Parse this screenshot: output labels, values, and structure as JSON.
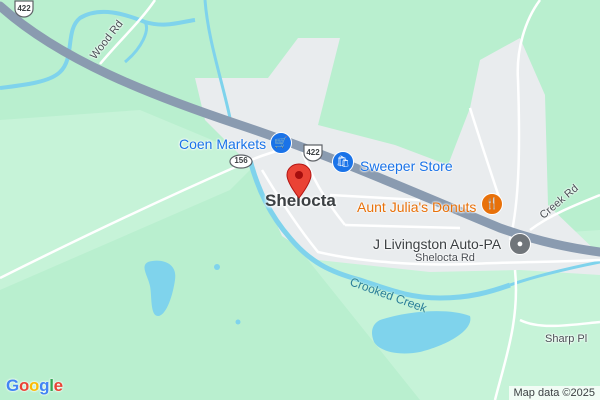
{
  "map": {
    "town": "Shelocta",
    "points_of_interest": [
      {
        "name": "Coen Markets",
        "icon": "shopping-bag-icon",
        "color": "#1a73e8"
      },
      {
        "name": "Sweeper Store",
        "icon": "shopping-bag-icon",
        "color": "#1a73e8"
      },
      {
        "name": "Aunt Julia's Donuts",
        "icon": "restaurant-icon",
        "color": "#e8710a"
      },
      {
        "name": "J Livingston Auto-PA",
        "icon": "location-circle-icon",
        "color": "#70757a"
      }
    ],
    "roads": {
      "wood_rd": "Wood Rd",
      "shelocta_rd": "Shelocta Rd",
      "creek_rd": "Creek Rd",
      "sharp_pl": "Sharp Pl"
    },
    "route_shields": {
      "us_422_top": "422",
      "us_422_mid": "422",
      "pa_156": "156"
    },
    "water": {
      "crooked_creek": "Crooked Creek"
    },
    "logo": {
      "letters": [
        "G",
        "o",
        "o",
        "g",
        "l",
        "e"
      ],
      "colors": [
        "#4285f4",
        "#ea4335",
        "#fbbc05",
        "#4285f4",
        "#34a853",
        "#ea4335"
      ]
    },
    "attribution": "Map data ©2025",
    "colors": {
      "land": "#b9efcf",
      "town_area": "#e9ecee",
      "highway": "#8a9bb0",
      "water": "#7fd3ec",
      "marker": "#ea4335"
    }
  }
}
